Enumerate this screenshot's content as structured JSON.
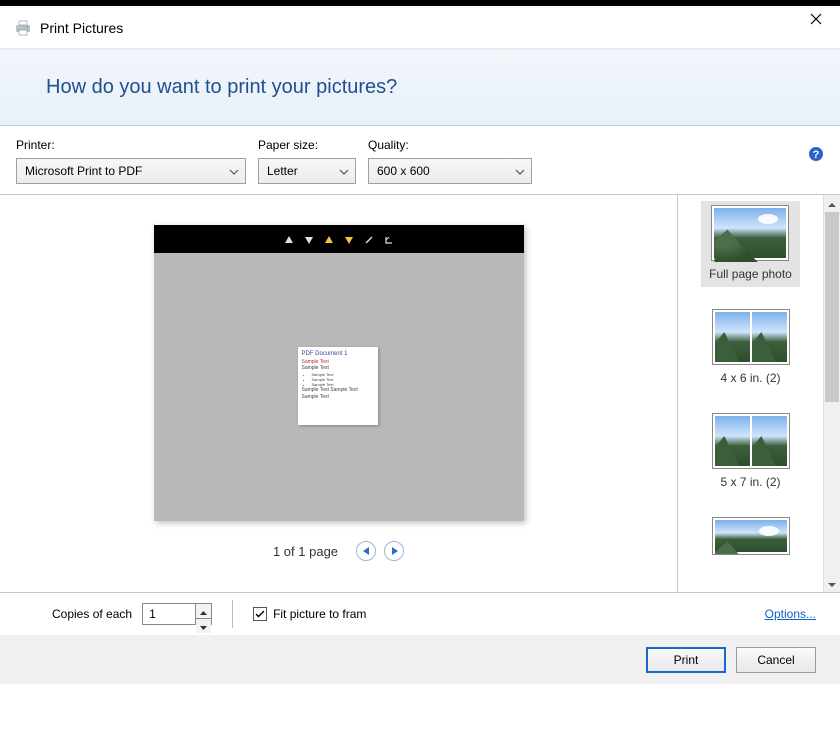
{
  "window": {
    "title": "Print Pictures"
  },
  "banner": {
    "heading": "How do you want to print your pictures?"
  },
  "selectors": {
    "printer": {
      "label": "Printer:",
      "value": "Microsoft Print to PDF"
    },
    "paper": {
      "label": "Paper size:",
      "value": "Letter"
    },
    "quality": {
      "label": "Quality:",
      "value": "600 x 600"
    }
  },
  "preview": {
    "doc_title": "PDF Document 1",
    "line1": "Sample Text",
    "line2": "Sample Text",
    "bullets": [
      "Sample Text",
      "Sample Text",
      "Sample Text"
    ],
    "foot": "Sample Text Sample Text Sample Text",
    "pager": "1 of 1 page"
  },
  "layouts": {
    "items": [
      {
        "label": "Full page photo"
      },
      {
        "label": "4 x 6 in. (2)"
      },
      {
        "label": "5 x 7 in. (2)"
      },
      {
        "label": ""
      }
    ]
  },
  "options": {
    "copies_label": "Copies of each",
    "copies_value": "1",
    "fit_label": "Fit picture to fram",
    "options_link": "Options..."
  },
  "footer": {
    "print": "Print",
    "cancel": "Cancel"
  }
}
